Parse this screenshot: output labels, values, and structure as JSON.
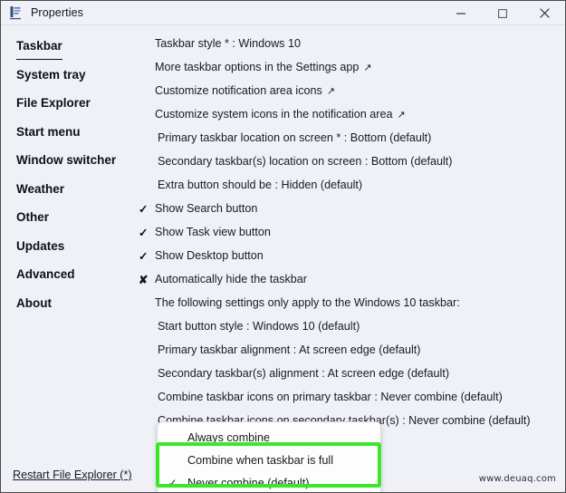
{
  "window": {
    "title": "Properties",
    "icon": "properties-window-icon",
    "controls": {
      "minimize": "—",
      "maximize": "☐",
      "close": "✕"
    },
    "accent_green": "#3ce628",
    "background": "#eff1f7"
  },
  "sidebar": {
    "items": [
      {
        "label": "Taskbar",
        "active": true
      },
      {
        "label": "System tray",
        "active": false
      },
      {
        "label": "File Explorer",
        "active": false
      },
      {
        "label": "Start menu",
        "active": false
      },
      {
        "label": "Window switcher",
        "active": false
      },
      {
        "label": "Weather",
        "active": false
      },
      {
        "label": "Other",
        "active": false
      },
      {
        "label": "Updates",
        "active": false
      },
      {
        "label": "Advanced",
        "active": false
      },
      {
        "label": "About",
        "active": false
      }
    ]
  },
  "content": {
    "rows": [
      {
        "mark": "",
        "label": "Taskbar style * : Windows 10",
        "ext": "",
        "indent": false
      },
      {
        "mark": "",
        "label": "More taskbar options in the Settings app",
        "ext": "↗",
        "indent": false
      },
      {
        "mark": "",
        "label": "Customize notification area icons",
        "ext": "↗",
        "indent": false
      },
      {
        "mark": "",
        "label": "Customize system icons in the notification area",
        "ext": "↗",
        "indent": false
      },
      {
        "mark": "",
        "label": "Primary taskbar location on screen * : Bottom (default)",
        "ext": "",
        "indent": true
      },
      {
        "mark": "",
        "label": "Secondary taskbar(s) location on screen : Bottom (default)",
        "ext": "",
        "indent": true
      },
      {
        "mark": "",
        "label": "Extra button should be : Hidden (default)",
        "ext": "",
        "indent": true
      },
      {
        "mark": "✓",
        "label": "Show Search button",
        "ext": "",
        "indent": false
      },
      {
        "mark": "✓",
        "label": "Show Task view button",
        "ext": "",
        "indent": false
      },
      {
        "mark": "✓",
        "label": "Show Desktop button",
        "ext": "",
        "indent": false
      },
      {
        "mark": "✘",
        "label": "Automatically hide the taskbar",
        "ext": "",
        "indent": false
      },
      {
        "mark": "",
        "label": "The following settings only apply to the Windows 10 taskbar:",
        "ext": "",
        "indent": false
      },
      {
        "mark": "",
        "label": "Start button style : Windows 10 (default)",
        "ext": "",
        "indent": true
      },
      {
        "mark": "",
        "label": "Primary taskbar alignment : At screen edge (default)",
        "ext": "",
        "indent": true
      },
      {
        "mark": "",
        "label": "Secondary taskbar(s) alignment : At screen edge (default)",
        "ext": "",
        "indent": true
      },
      {
        "mark": "",
        "label": "Combine taskbar icons on primary taskbar : Never combine (default)",
        "ext": "",
        "indent": true
      },
      {
        "mark": "",
        "label": "Combine taskbar icons on secondary taskbar(s) : Never combine (default)",
        "ext": "",
        "indent": true
      }
    ]
  },
  "dropdown": {
    "options": [
      {
        "check": "",
        "label": "Always combine"
      },
      {
        "check": "",
        "label": "Combine when taskbar is full"
      },
      {
        "check": "✓",
        "label": "Never combine (default)"
      }
    ]
  },
  "footer": {
    "restart_link": "Restart File Explorer (*)",
    "watermark": "www.deuaq.com"
  }
}
